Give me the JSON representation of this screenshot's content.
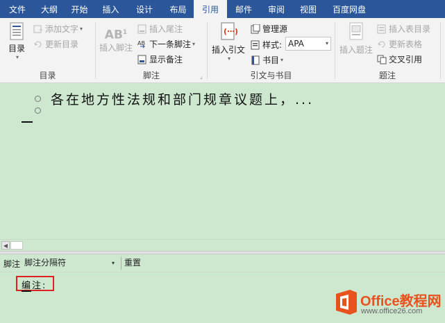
{
  "tabs": [
    {
      "label": "文件",
      "active": false
    },
    {
      "label": "大纲",
      "active": false
    },
    {
      "label": "开始",
      "active": false
    },
    {
      "label": "插入",
      "active": false
    },
    {
      "label": "设计",
      "active": false
    },
    {
      "label": "布局",
      "active": false
    },
    {
      "label": "引用",
      "active": true
    },
    {
      "label": "邮件",
      "active": false
    },
    {
      "label": "审阅",
      "active": false
    },
    {
      "label": "视图",
      "active": false
    },
    {
      "label": "百度网盘",
      "active": false
    }
  ],
  "ribbon": {
    "toc": {
      "label": "目录",
      "big_button": "目录",
      "add_text": "添加文字",
      "update_toc": "更新目录"
    },
    "footnotes": {
      "label": "脚注",
      "insert_footnote": "插入脚注",
      "insert_endnote": "插入尾注",
      "next_footnote": "下一条脚注",
      "show_notes": "显示备注"
    },
    "citations": {
      "label": "引文与书目",
      "insert_citation": "插入引文",
      "manage_sources": "管理源",
      "style_label": "样式:",
      "style_value": "APA",
      "bibliography": "书目"
    },
    "captions": {
      "label": "题注",
      "insert_caption": "插入题注",
      "insert_table_of_figures": "插入表目录",
      "update_table": "更新表格",
      "cross_reference": "交叉引用"
    }
  },
  "document": {
    "line1": "各在地方性法规和部门规章议题上，...",
    "line2": ""
  },
  "footnote_pane": {
    "label": "脚注",
    "select_value": "脚注分隔符",
    "reset": "重置",
    "note_text": "编注:"
  },
  "watermark": {
    "title": "Office教程网",
    "url": "www.office26.com"
  },
  "colors": {
    "tab_bar": "#2b579a",
    "document_bg": "#cde8cf",
    "highlight_box": "#e02020",
    "watermark_orange": "#e8521e"
  }
}
